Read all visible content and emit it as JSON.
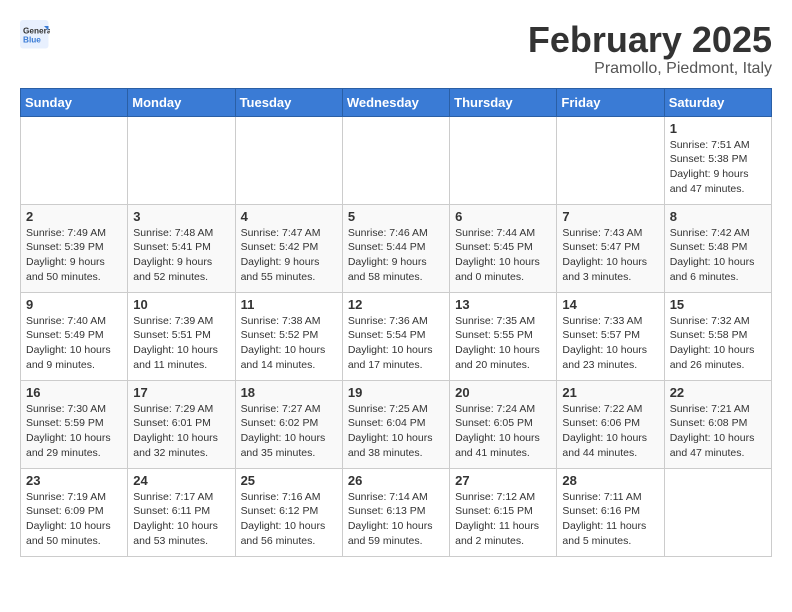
{
  "header": {
    "logo_general": "General",
    "logo_blue": "Blue",
    "month_year": "February 2025",
    "location": "Pramollo, Piedmont, Italy"
  },
  "calendar": {
    "days_of_week": [
      "Sunday",
      "Monday",
      "Tuesday",
      "Wednesday",
      "Thursday",
      "Friday",
      "Saturday"
    ],
    "weeks": [
      [
        {
          "day": "",
          "info": ""
        },
        {
          "day": "",
          "info": ""
        },
        {
          "day": "",
          "info": ""
        },
        {
          "day": "",
          "info": ""
        },
        {
          "day": "",
          "info": ""
        },
        {
          "day": "",
          "info": ""
        },
        {
          "day": "1",
          "info": "Sunrise: 7:51 AM\nSunset: 5:38 PM\nDaylight: 9 hours and 47 minutes."
        }
      ],
      [
        {
          "day": "2",
          "info": "Sunrise: 7:49 AM\nSunset: 5:39 PM\nDaylight: 9 hours and 50 minutes."
        },
        {
          "day": "3",
          "info": "Sunrise: 7:48 AM\nSunset: 5:41 PM\nDaylight: 9 hours and 52 minutes."
        },
        {
          "day": "4",
          "info": "Sunrise: 7:47 AM\nSunset: 5:42 PM\nDaylight: 9 hours and 55 minutes."
        },
        {
          "day": "5",
          "info": "Sunrise: 7:46 AM\nSunset: 5:44 PM\nDaylight: 9 hours and 58 minutes."
        },
        {
          "day": "6",
          "info": "Sunrise: 7:44 AM\nSunset: 5:45 PM\nDaylight: 10 hours and 0 minutes."
        },
        {
          "day": "7",
          "info": "Sunrise: 7:43 AM\nSunset: 5:47 PM\nDaylight: 10 hours and 3 minutes."
        },
        {
          "day": "8",
          "info": "Sunrise: 7:42 AM\nSunset: 5:48 PM\nDaylight: 10 hours and 6 minutes."
        }
      ],
      [
        {
          "day": "9",
          "info": "Sunrise: 7:40 AM\nSunset: 5:49 PM\nDaylight: 10 hours and 9 minutes."
        },
        {
          "day": "10",
          "info": "Sunrise: 7:39 AM\nSunset: 5:51 PM\nDaylight: 10 hours and 11 minutes."
        },
        {
          "day": "11",
          "info": "Sunrise: 7:38 AM\nSunset: 5:52 PM\nDaylight: 10 hours and 14 minutes."
        },
        {
          "day": "12",
          "info": "Sunrise: 7:36 AM\nSunset: 5:54 PM\nDaylight: 10 hours and 17 minutes."
        },
        {
          "day": "13",
          "info": "Sunrise: 7:35 AM\nSunset: 5:55 PM\nDaylight: 10 hours and 20 minutes."
        },
        {
          "day": "14",
          "info": "Sunrise: 7:33 AM\nSunset: 5:57 PM\nDaylight: 10 hours and 23 minutes."
        },
        {
          "day": "15",
          "info": "Sunrise: 7:32 AM\nSunset: 5:58 PM\nDaylight: 10 hours and 26 minutes."
        }
      ],
      [
        {
          "day": "16",
          "info": "Sunrise: 7:30 AM\nSunset: 5:59 PM\nDaylight: 10 hours and 29 minutes."
        },
        {
          "day": "17",
          "info": "Sunrise: 7:29 AM\nSunset: 6:01 PM\nDaylight: 10 hours and 32 minutes."
        },
        {
          "day": "18",
          "info": "Sunrise: 7:27 AM\nSunset: 6:02 PM\nDaylight: 10 hours and 35 minutes."
        },
        {
          "day": "19",
          "info": "Sunrise: 7:25 AM\nSunset: 6:04 PM\nDaylight: 10 hours and 38 minutes."
        },
        {
          "day": "20",
          "info": "Sunrise: 7:24 AM\nSunset: 6:05 PM\nDaylight: 10 hours and 41 minutes."
        },
        {
          "day": "21",
          "info": "Sunrise: 7:22 AM\nSunset: 6:06 PM\nDaylight: 10 hours and 44 minutes."
        },
        {
          "day": "22",
          "info": "Sunrise: 7:21 AM\nSunset: 6:08 PM\nDaylight: 10 hours and 47 minutes."
        }
      ],
      [
        {
          "day": "23",
          "info": "Sunrise: 7:19 AM\nSunset: 6:09 PM\nDaylight: 10 hours and 50 minutes."
        },
        {
          "day": "24",
          "info": "Sunrise: 7:17 AM\nSunset: 6:11 PM\nDaylight: 10 hours and 53 minutes."
        },
        {
          "day": "25",
          "info": "Sunrise: 7:16 AM\nSunset: 6:12 PM\nDaylight: 10 hours and 56 minutes."
        },
        {
          "day": "26",
          "info": "Sunrise: 7:14 AM\nSunset: 6:13 PM\nDaylight: 10 hours and 59 minutes."
        },
        {
          "day": "27",
          "info": "Sunrise: 7:12 AM\nSunset: 6:15 PM\nDaylight: 11 hours and 2 minutes."
        },
        {
          "day": "28",
          "info": "Sunrise: 7:11 AM\nSunset: 6:16 PM\nDaylight: 11 hours and 5 minutes."
        },
        {
          "day": "",
          "info": ""
        }
      ]
    ]
  }
}
